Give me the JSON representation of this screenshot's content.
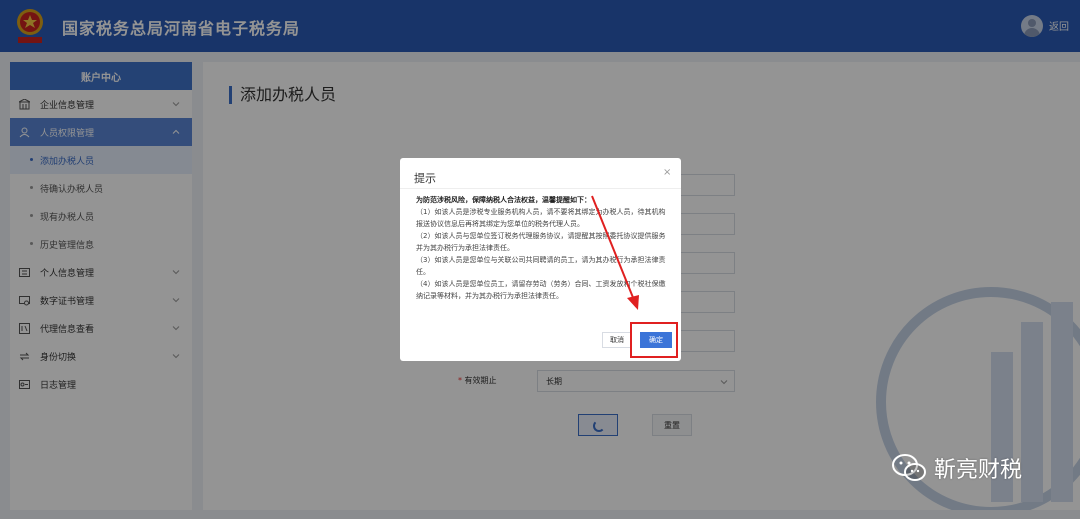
{
  "header": {
    "title": "国家税务总局河南省电子税务局",
    "return_label": "返回"
  },
  "sidebar": {
    "heading": "账户中心",
    "items": [
      {
        "label": "企业信息管理",
        "icon": "building-icon",
        "open": false
      },
      {
        "label": "人员权限管理",
        "icon": "user-lock-icon",
        "open": true,
        "children": [
          {
            "label": "添加办税人员",
            "active": true
          },
          {
            "label": "待确认办税人员",
            "active": false
          },
          {
            "label": "现有办税人员",
            "active": false
          },
          {
            "label": "历史管理信息",
            "active": false
          }
        ]
      },
      {
        "label": "个人信息管理",
        "icon": "id-card-icon",
        "open": false
      },
      {
        "label": "数字证书管理",
        "icon": "certificate-icon",
        "open": false
      },
      {
        "label": "代理信息查看",
        "icon": "agent-icon",
        "open": false
      },
      {
        "label": "身份切换",
        "icon": "switch-icon",
        "open": false
      },
      {
        "label": "日志管理",
        "icon": "log-icon",
        "open": false
      }
    ]
  },
  "main": {
    "page_title": "添加办税人员",
    "validity_label": "有效期止",
    "validity_value": "长期",
    "reset_label": "重置"
  },
  "dialog": {
    "title": "提示",
    "close": "×",
    "lead": "为防范涉税风险，保障纳税人合法权益，温馨提醒如下：",
    "paragraphs": [
      "（1）如该人员是涉税专业服务机构人员，请不要将其绑定为办税人员，待其机构报送协议信息后再将其绑定为您单位的税务代理人员。",
      "（2）如该人员与您单位签订税务代理服务协议，请提醒其按照委托协议提供服务并为其办税行为承担法律责任。",
      "（3）如该人员是您单位与关联公司共同聘请的员工，请为其办税行为承担法律责任。",
      "（4）如该人员是您单位员工，请留存劳动（劳务）合同、工资发放和个税社保缴纳记录等材料，并为其办税行为承担法律责任。"
    ],
    "cancel_label": "取消",
    "ok_label": "确定"
  },
  "watermark": {
    "wechat_text": "靳亮财税"
  },
  "colors": {
    "header_bg": "#2a5bb5",
    "accent": "#3b74d8",
    "annotation_red": "#e02020"
  }
}
